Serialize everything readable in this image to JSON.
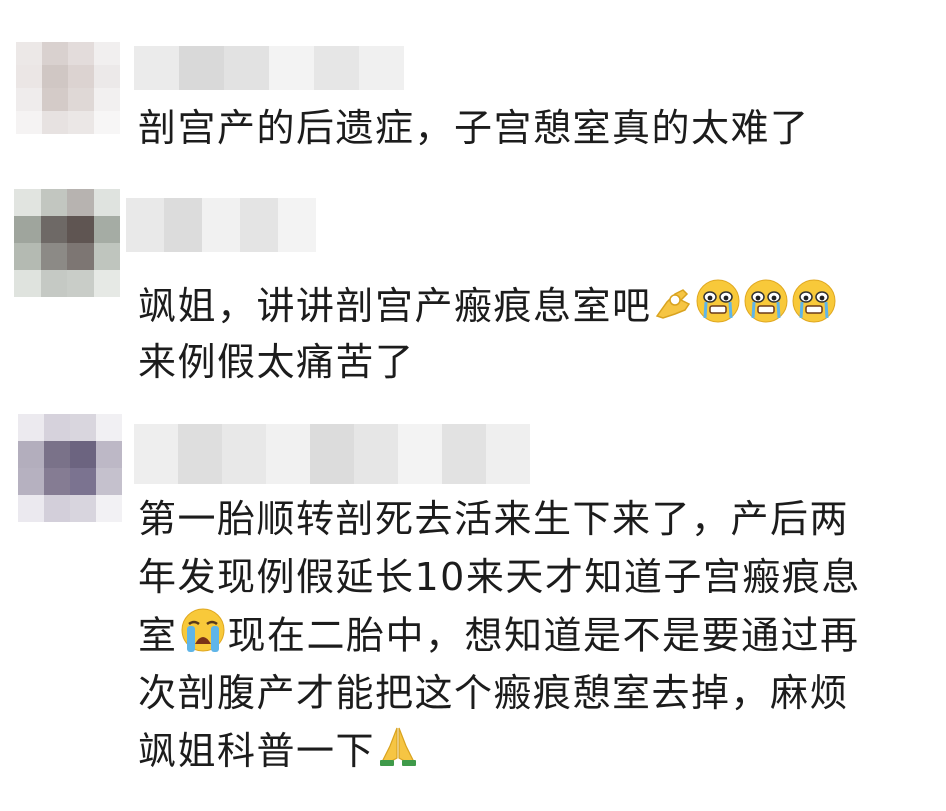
{
  "comments": [
    {
      "username": "",
      "lines": [
        "剖宫产的后遗症，子宫憩室真的太难了"
      ],
      "emojis": []
    },
    {
      "username": "",
      "lines": [
        "飒姐，讲讲剖宫产瘢痕息室吧",
        "来例假太痛苦了"
      ],
      "emojis": [
        "ok-hand-emoji",
        "crying-face-emoji",
        "crying-face-emoji",
        "crying-face-emoji"
      ]
    },
    {
      "username": "",
      "lines": [
        "第一胎顺转剖死去活来生下来了，产后两",
        "年发现例假延长10来天才知道子宫瘢痕息",
        "室",
        "现在二胎中，想知道是不是要通过再",
        "次剖腹产才能把这个瘢痕憩室去掉，麻烦",
        "飒姐科普一下"
      ],
      "emojis": [
        "loudly-crying-emoji",
        "folded-hands-emoji"
      ]
    }
  ]
}
